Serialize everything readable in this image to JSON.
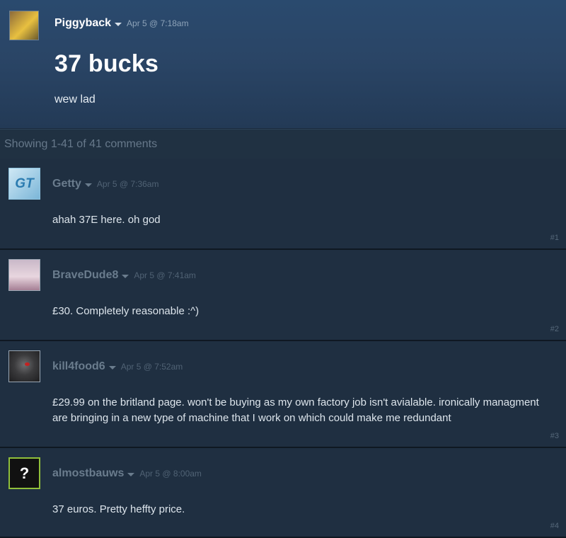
{
  "topic": {
    "author": "Piggyback",
    "time": "Apr 5 @ 7:18am",
    "title": "37 bucks",
    "body": "wew lad"
  },
  "count_text": "Showing 1-41 of 41 comments",
  "comments": [
    {
      "author": "Getty",
      "time": "Apr 5 @ 7:36am",
      "text": "ahah 37E here. oh god",
      "num": "#1",
      "avatar_text": "GT"
    },
    {
      "author": "BraveDude8",
      "time": "Apr 5 @ 7:41am",
      "text": "£30. Completely reasonable :^)",
      "num": "#2"
    },
    {
      "author": "kill4food6",
      "time": "Apr 5 @ 7:52am",
      "text": "£29.99 on the britland page. won't be buying as my own factory job isn't avialable. ironically managment are bringing in a new type of machine that I work on which could make me redundant",
      "num": "#3"
    },
    {
      "author": "almostbauws",
      "time": "Apr 5 @ 8:00am",
      "text": "37 euros. Pretty heffty price.",
      "num": "#4",
      "avatar_text": "?"
    }
  ]
}
